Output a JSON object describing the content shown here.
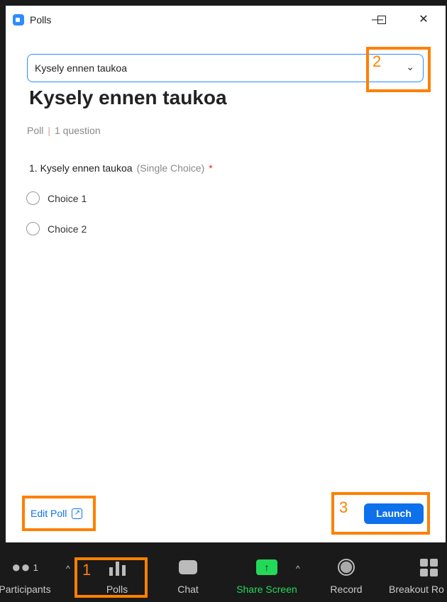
{
  "window": {
    "title": "Polls"
  },
  "poll_select": {
    "value": "Kysely ennen taukoa"
  },
  "poll": {
    "title": "Kysely ennen taukoa",
    "kind": "Poll",
    "count": "1 question",
    "question": {
      "text": "1. Kysely ennen taukoa",
      "type": "(Single Choice)",
      "required": "*"
    },
    "choices": [
      "Choice 1",
      "Choice 2"
    ]
  },
  "footer": {
    "edit_label": "Edit Poll",
    "launch_label": "Launch"
  },
  "annotations": [
    "1",
    "2",
    "3"
  ],
  "toolbar": {
    "participants_label": "Participants",
    "participants_count": "1",
    "polls_label": "Polls",
    "chat_label": "Chat",
    "share_label": "Share Screen",
    "record_label": "Record",
    "breakout_label": "Breakout Ro"
  },
  "colors": {
    "accent": "#0e71eb",
    "annotation": "#ff8000",
    "share": "#23d959"
  }
}
